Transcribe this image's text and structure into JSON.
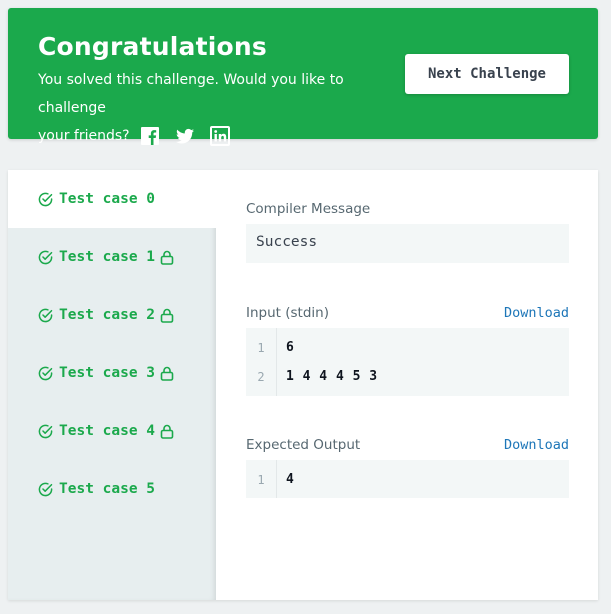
{
  "banner": {
    "title": "Congratulations",
    "message_line1": "You solved this challenge. Would you like to challenge",
    "message_line2": "your friends?",
    "social_icons": [
      "facebook-icon",
      "twitter-icon",
      "linkedin-icon"
    ],
    "next_button": "Next Challenge",
    "color": "#1ba94c"
  },
  "test_cases": [
    {
      "label": "Test case 0",
      "locked": false,
      "active": true
    },
    {
      "label": "Test case 1",
      "locked": true,
      "active": false
    },
    {
      "label": "Test case 2",
      "locked": true,
      "active": false
    },
    {
      "label": "Test case 3",
      "locked": true,
      "active": false
    },
    {
      "label": "Test case 4",
      "locked": true,
      "active": false
    },
    {
      "label": "Test case 5",
      "locked": false,
      "active": false
    }
  ],
  "compiler": {
    "label": "Compiler Message",
    "message": "Success"
  },
  "input": {
    "label": "Input (stdin)",
    "download": "Download",
    "lines": [
      {
        "num": "1",
        "text": "6"
      },
      {
        "num": "2",
        "text": "1 4 4 4 5 3"
      }
    ]
  },
  "expected": {
    "label": "Expected Output",
    "download": "Download",
    "lines": [
      {
        "num": "1",
        "text": "4"
      }
    ]
  }
}
